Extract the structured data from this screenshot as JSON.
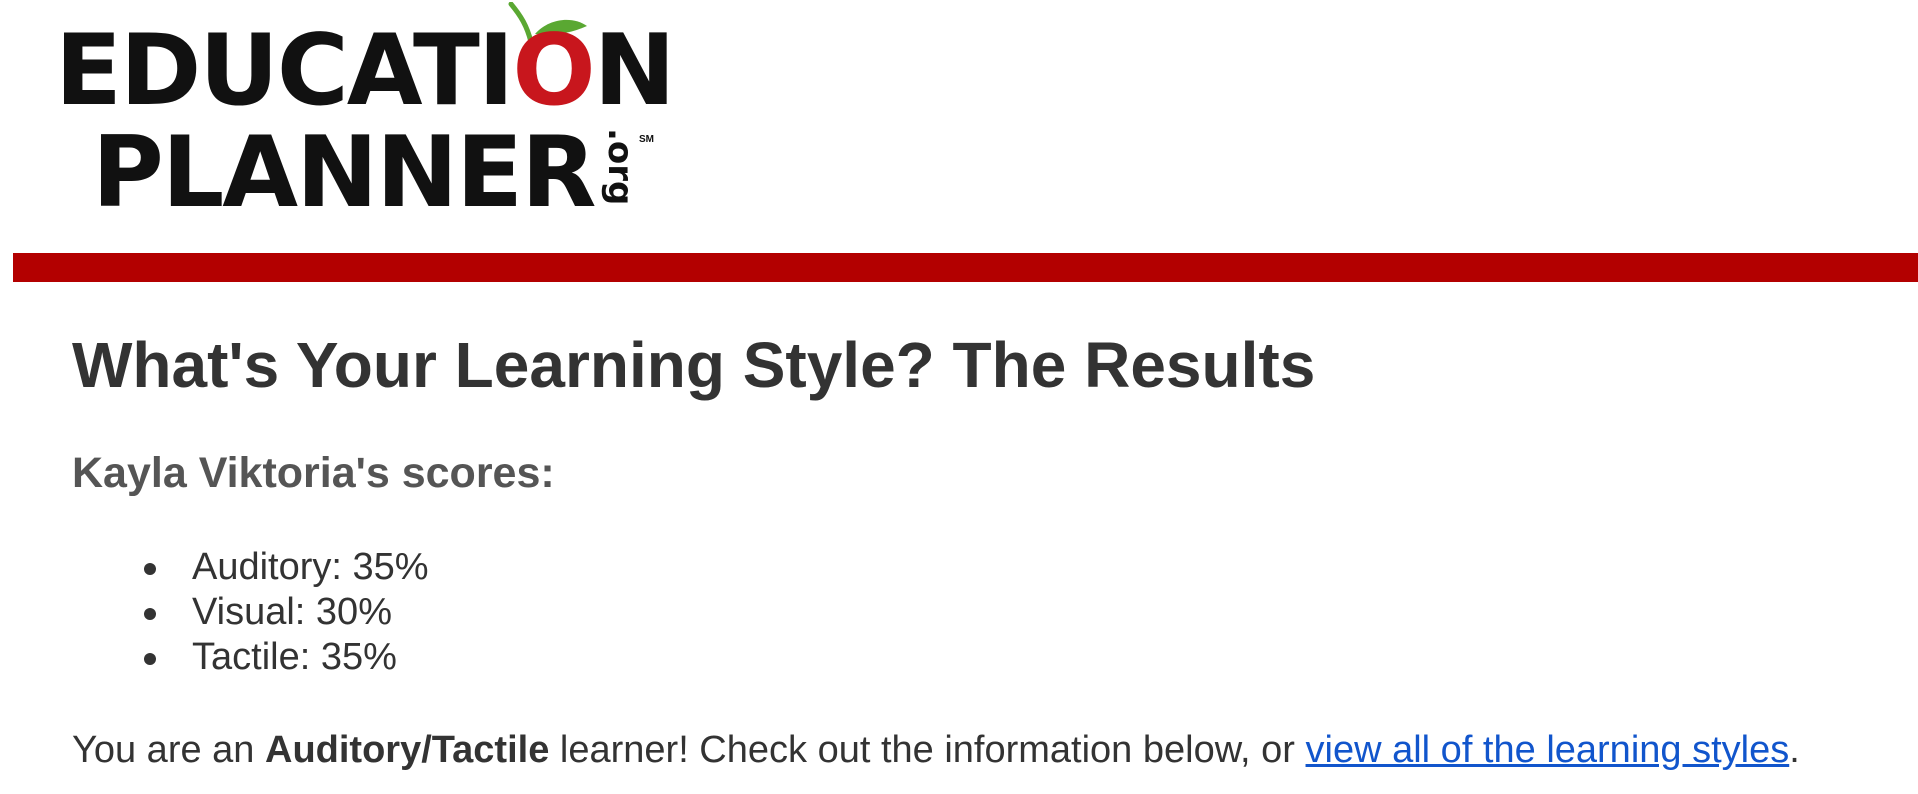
{
  "logo": {
    "line1_before_o": "EDUCATI",
    "line1_o": "O",
    "line1_after_o": "N",
    "line2": "PLANNER",
    "suffix": ".org",
    "service_mark": "SM"
  },
  "colors": {
    "accent_bar": "#b30000",
    "logo_apple": "#c8161d",
    "leaf": "#5aa832",
    "link": "#1155cc",
    "heading": "#333333",
    "subheading": "#555555"
  },
  "page": {
    "title": "What's Your Learning Style? The Results",
    "subtitle": "Kayla Viktoria's scores:"
  },
  "scores": [
    {
      "label": "Auditory",
      "percent": 35,
      "text": "Auditory: 35%"
    },
    {
      "label": "Visual",
      "percent": 30,
      "text": "Visual: 30%"
    },
    {
      "label": "Tactile",
      "percent": 35,
      "text": "Tactile: 35%"
    }
  ],
  "summary": {
    "prefix": "You are an ",
    "learner_type": "Auditory/Tactile",
    "middle": " learner! Check out the information below, or ",
    "link_text": "view all of the learning styles",
    "suffix": "."
  }
}
